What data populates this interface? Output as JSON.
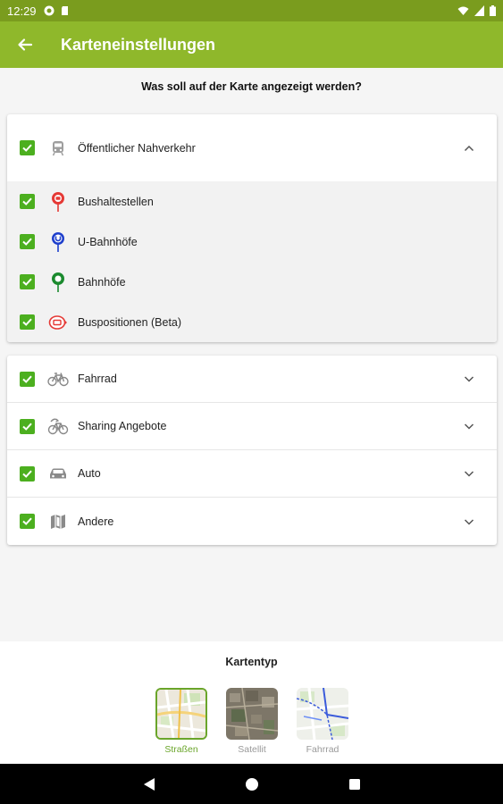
{
  "status": {
    "time": "12:29"
  },
  "appbar": {
    "title": "Karteneinstellungen"
  },
  "question": "Was soll auf der Karte angezeigt werden?",
  "public_transport": {
    "label": "Öffentlicher Nahverkehr",
    "items": [
      {
        "label": "Bushaltestellen",
        "color": "#e53935"
      },
      {
        "label": "U-Bahnhöfe",
        "color": "#1e3fcc"
      },
      {
        "label": "Bahnhöfe",
        "color": "#1b8a2e"
      },
      {
        "label": "Buspositionen (Beta)",
        "color": "#e53935"
      }
    ]
  },
  "categories": [
    {
      "label": "Fahrrad"
    },
    {
      "label": "Sharing Angebote"
    },
    {
      "label": "Auto"
    },
    {
      "label": "Andere"
    }
  ],
  "map_type": {
    "title": "Kartentyp",
    "options": [
      {
        "label": "Straßen",
        "selected": true
      },
      {
        "label": "Satellit",
        "selected": false
      },
      {
        "label": "Fahrrad",
        "selected": false
      }
    ]
  },
  "colors": {
    "appbar": "#8fb82b",
    "statusbar": "#7a9c1e",
    "checkbox": "#4caf1f",
    "selected": "#6aa52a"
  }
}
